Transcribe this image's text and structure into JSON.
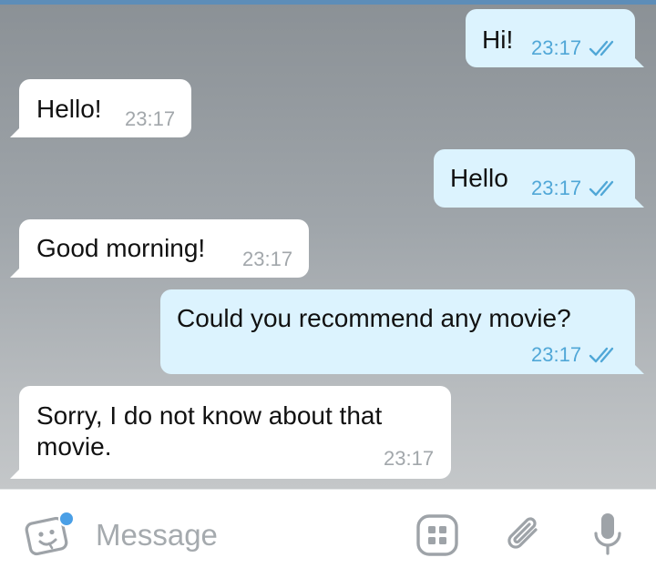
{
  "messages": [
    {
      "direction": "outgoing",
      "text": "Hi!",
      "time": "23:17",
      "status_icon": "double-check-icon"
    },
    {
      "direction": "incoming",
      "text": "Hello!",
      "time": "23:17"
    },
    {
      "direction": "outgoing",
      "text": "Hello",
      "time": "23:17",
      "status_icon": "double-check-icon"
    },
    {
      "direction": "incoming",
      "text": "Good morning!",
      "time": "23:17"
    },
    {
      "direction": "outgoing",
      "text": "Could you recommend any movie?",
      "time": "23:17",
      "status_icon": "double-check-icon"
    },
    {
      "direction": "incoming",
      "text": "Sorry, I do not know about that movie.",
      "time": "23:17"
    }
  ],
  "input_bar": {
    "placeholder": "Message",
    "left_icon": "sticker-icon",
    "right_icons": [
      "bot-commands-icon",
      "attach-icon",
      "microphone-icon"
    ]
  },
  "colors": {
    "outgoing_bubble": "#dcf3fe",
    "incoming_bubble": "#ffffff",
    "outgoing_meta": "#50a7d7",
    "incoming_meta": "#a2a7ab",
    "accent": "#4a9fe6",
    "icon_gray": "#9ea3a8"
  }
}
